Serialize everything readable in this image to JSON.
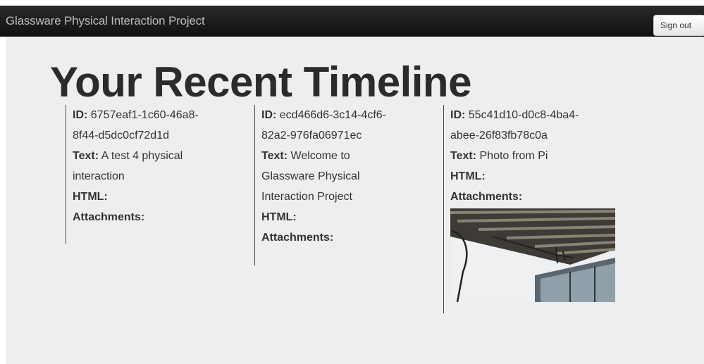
{
  "header": {
    "brand": "Glassware Physical Interaction Project",
    "signout_label": "Sign out"
  },
  "page_title": "Your Recent Timeline",
  "labels": {
    "id": "ID:",
    "text": "Text:",
    "html": "HTML:",
    "attachments": "Attachments:"
  },
  "timeline": [
    {
      "id_line1": "6757eaf1-1c60-46a8-",
      "id_line2": "8f44-d5dc0cf72d1d",
      "text_line1": "A test 4 physical",
      "text_line2": "interaction"
    },
    {
      "id_line1": "ecd466d6-3c14-4cf6-",
      "id_line2": "82a2-976fa06971ec",
      "text_line1": "Welcome to",
      "text_line2": "Glassware Physical",
      "text_line3": "Interaction Project"
    },
    {
      "id_line1": "55c41d10-d0c8-4ba4-",
      "id_line2": "abee-26f83fb78c0a",
      "text_line1": "Photo from Pi",
      "attachment": "photo"
    }
  ]
}
